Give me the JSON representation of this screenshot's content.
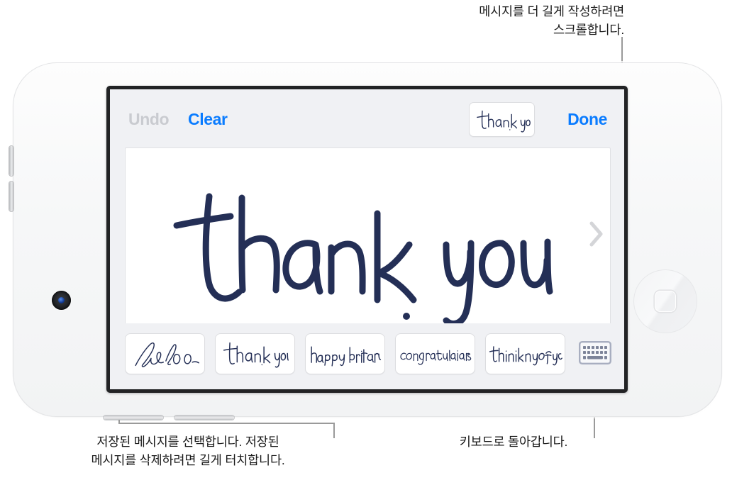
{
  "callouts": {
    "top": "메시지를 더 길게 작성하려면\n스크롤합니다.",
    "bottom_left": "저장된 메시지를 선택합니다. 저장된\n메시지를 삭제하려면 길게 터치합니다.",
    "bottom_right": "키보드로 돌아갑니다."
  },
  "device": {
    "name": "iPod touch",
    "orientation": "landscape"
  },
  "screen": {
    "toolbar": {
      "undo_label": "Undo",
      "undo_enabled": false,
      "clear_label": "Clear",
      "done_label": "Done",
      "preview_text": "thank you",
      "accent_color": "#0a7cff",
      "disabled_color": "#c9cbd0"
    },
    "canvas": {
      "handwriting_text": "thank you",
      "ink_color": "#242f56",
      "background": "#ffffff",
      "scroll_hint_icon": "chevron-right-icon"
    },
    "suggestions": {
      "items": [
        {
          "text": "hello"
        },
        {
          "text": "thank you"
        },
        {
          "text": "happy birthday"
        },
        {
          "text": "congratulations"
        },
        {
          "text": "thinking of you"
        }
      ],
      "keyboard_button_icon": "keyboard-icon"
    }
  }
}
